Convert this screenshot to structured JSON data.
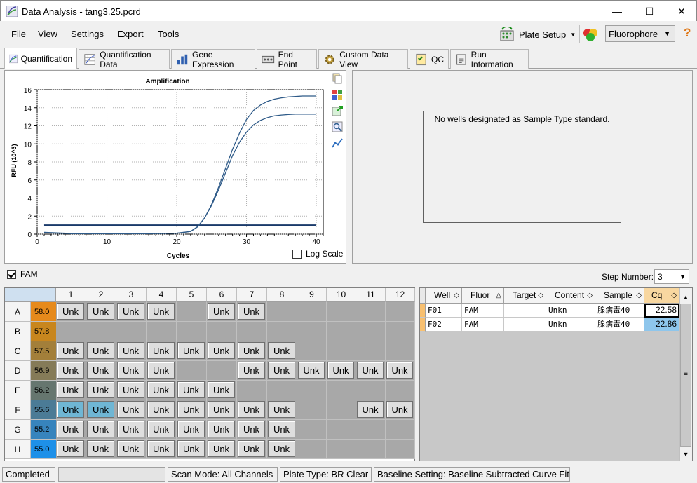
{
  "window": {
    "title": "Data Analysis - tang3.25.pcrd",
    "minimize": "—",
    "maximize": "☐",
    "close": "✕"
  },
  "menu": [
    "File",
    "View",
    "Settings",
    "Export",
    "Tools"
  ],
  "toolbar": {
    "plate_setup": "Plate Setup",
    "fluorophore": "Fluorophore",
    "help": "?"
  },
  "tabs": [
    "Quantification",
    "Quantification Data",
    "Gene Expression",
    "End Point",
    "Custom Data View",
    "QC",
    "Run Information"
  ],
  "chart_data": {
    "type": "line",
    "title": "Amplification",
    "xlabel": "Cycles",
    "ylabel": "RFU (10^3)",
    "xlim": [
      0,
      41
    ],
    "ylim": [
      0,
      16
    ],
    "xticks": [
      0,
      10,
      20,
      30,
      40
    ],
    "yticks": [
      0,
      2,
      4,
      6,
      8,
      10,
      12,
      14,
      16
    ],
    "threshold": 1.0,
    "series": [
      {
        "x": [
          1,
          5,
          10,
          15,
          20,
          22,
          23,
          24,
          25,
          26,
          27,
          28,
          29,
          30,
          31,
          32,
          33,
          34,
          35,
          36,
          37,
          38,
          39,
          40
        ],
        "y": [
          0.15,
          0.05,
          0.05,
          0.05,
          0.1,
          0.3,
          0.8,
          1.8,
          3.3,
          5.2,
          7.3,
          9.4,
          11.2,
          12.7,
          13.7,
          14.3,
          14.7,
          14.95,
          15.1,
          15.2,
          15.25,
          15.3,
          15.3,
          15.3
        ]
      },
      {
        "x": [
          1,
          5,
          10,
          15,
          20,
          22,
          23,
          24,
          25,
          26,
          27,
          28,
          29,
          30,
          31,
          32,
          33,
          34,
          35,
          36,
          37,
          38,
          39,
          40
        ],
        "y": [
          0.2,
          0.08,
          0.05,
          0.05,
          0.1,
          0.3,
          0.85,
          1.8,
          3.2,
          4.9,
          6.8,
          8.7,
          10.2,
          11.3,
          12.1,
          12.6,
          12.9,
          13.1,
          13.2,
          13.25,
          13.3,
          13.3,
          13.3,
          13.3
        ]
      }
    ]
  },
  "log_scale_label": "Log Scale",
  "no_standard_msg": "No wells designated as Sample Type standard.",
  "fam_label": "FAM",
  "step_number": {
    "label": "Step Number:",
    "value": "3"
  },
  "plate": {
    "columns": [
      "1",
      "2",
      "3",
      "4",
      "5",
      "6",
      "7",
      "8",
      "9",
      "10",
      "11",
      "12"
    ],
    "rows": [
      {
        "row": "A",
        "temp": "58.0",
        "tcolor": "#e68a1c",
        "cells": [
          "Unk",
          "Unk",
          "Unk",
          "Unk",
          "",
          "Unk",
          "Unk",
          "",
          "",
          "",
          "",
          ""
        ]
      },
      {
        "row": "B",
        "temp": "57.8",
        "tcolor": "#c8861e",
        "cells": [
          "",
          "",
          "",
          "",
          "",
          "",
          "",
          "",
          "",
          "",
          "",
          ""
        ]
      },
      {
        "row": "C",
        "temp": "57.5",
        "tcolor": "#a37f3a",
        "cells": [
          "Unk",
          "Unk",
          "Unk",
          "Unk",
          "Unk",
          "Unk",
          "Unk",
          "Unk",
          "",
          "",
          "",
          ""
        ]
      },
      {
        "row": "D",
        "temp": "56.9",
        "tcolor": "#857b58",
        "cells": [
          "Unk",
          "Unk",
          "Unk",
          "Unk",
          "",
          "",
          "Unk",
          "Unk",
          "Unk",
          "Unk",
          "Unk",
          "Unk"
        ]
      },
      {
        "row": "E",
        "temp": "56.2",
        "tcolor": "#66766f",
        "cells": [
          "Unk",
          "Unk",
          "Unk",
          "Unk",
          "Unk",
          "Unk",
          "",
          "",
          "",
          "",
          "",
          ""
        ]
      },
      {
        "row": "F",
        "temp": "55.6",
        "tcolor": "#4b7b96",
        "cells": [
          "Unk",
          "Unk",
          "Unk",
          "Unk",
          "Unk",
          "Unk",
          "Unk",
          "Unk",
          "",
          "",
          "Unk",
          "Unk"
        ]
      },
      {
        "row": "G",
        "temp": "55.2",
        "tcolor": "#3784bd",
        "cells": [
          "Unk",
          "Unk",
          "Unk",
          "Unk",
          "Unk",
          "Unk",
          "Unk",
          "Unk",
          "",
          "",
          "",
          ""
        ]
      },
      {
        "row": "H",
        "temp": "55.0",
        "tcolor": "#1e90e8",
        "cells": [
          "Unk",
          "Unk",
          "Unk",
          "Unk",
          "Unk",
          "Unk",
          "Unk",
          "Unk",
          "",
          "",
          "",
          ""
        ]
      }
    ],
    "selected": [
      "F1",
      "F2"
    ]
  },
  "well_table": {
    "headers": [
      "Well",
      "Fluor",
      "Target",
      "Content",
      "Sample",
      "Cq"
    ],
    "rows": [
      [
        "F01",
        "FAM",
        "",
        "Unkn",
        "腺病毒40",
        "22.58"
      ],
      [
        "F02",
        "FAM",
        "",
        "Unkn",
        "腺病毒40",
        "22.86"
      ]
    ]
  },
  "status": {
    "state": "Completed",
    "scan_mode": "Scan Mode: All Channels",
    "plate_type": "Plate Type: BR Clear",
    "baseline": "Baseline Setting: Baseline Subtracted Curve Fit"
  }
}
